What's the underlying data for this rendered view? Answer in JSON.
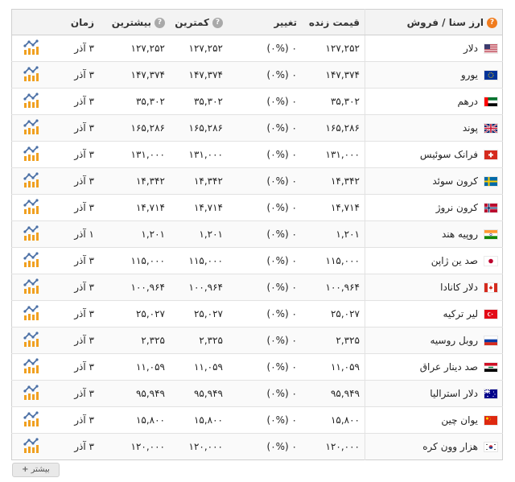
{
  "header": {
    "currency": "ارز سنا / فروش",
    "price": "قیمت زنده",
    "change": "تغییر",
    "low": "کمترین",
    "high": "بیشترین",
    "time": "زمان",
    "help_icon": "?"
  },
  "rows": [
    {
      "name": "دلار",
      "flag": "us-flag-icon",
      "price": "۱۲۷,۲۵۲",
      "change": "۰ (۰%)",
      "low": "۱۲۷,۲۵۲",
      "high": "۱۲۷,۲۵۲",
      "time": "۳ آذر"
    },
    {
      "name": "یورو",
      "flag": "eu-flag-icon",
      "price": "۱۴۷,۳۷۴",
      "change": "۰ (۰%)",
      "low": "۱۴۷,۳۷۴",
      "high": "۱۴۷,۳۷۴",
      "time": "۳ آذر"
    },
    {
      "name": "درهم",
      "flag": "ae-flag-icon",
      "price": "۳۵,۳۰۲",
      "change": "۰ (۰%)",
      "low": "۳۵,۳۰۲",
      "high": "۳۵,۳۰۲",
      "time": "۳ آذر"
    },
    {
      "name": "پوند",
      "flag": "gb-flag-icon",
      "price": "۱۶۵,۲۸۶",
      "change": "۰ (۰%)",
      "low": "۱۶۵,۲۸۶",
      "high": "۱۶۵,۲۸۶",
      "time": "۳ آذر"
    },
    {
      "name": "فرانک سوئیس",
      "flag": "ch-flag-icon",
      "price": "۱۳۱,۰۰۰",
      "change": "۰ (۰%)",
      "low": "۱۳۱,۰۰۰",
      "high": "۱۳۱,۰۰۰",
      "time": "۳ آذر"
    },
    {
      "name": "کرون سوئد",
      "flag": "se-flag-icon",
      "price": "۱۴,۳۴۲",
      "change": "۰ (۰%)",
      "low": "۱۴,۳۴۲",
      "high": "۱۴,۳۴۲",
      "time": "۳ آذر"
    },
    {
      "name": "کرون نروژ",
      "flag": "no-flag-icon",
      "price": "۱۴,۷۱۴",
      "change": "۰ (۰%)",
      "low": "۱۴,۷۱۴",
      "high": "۱۴,۷۱۴",
      "time": "۳ آذر"
    },
    {
      "name": "روپیه هند",
      "flag": "in-flag-icon",
      "price": "۱,۲۰۱",
      "change": "۰ (۰%)",
      "low": "۱,۲۰۱",
      "high": "۱,۲۰۱",
      "time": "۱ آذر"
    },
    {
      "name": "صد ین ژاپن",
      "flag": "jp-flag-icon",
      "price": "۱۱۵,۰۰۰",
      "change": "۰ (۰%)",
      "low": "۱۱۵,۰۰۰",
      "high": "۱۱۵,۰۰۰",
      "time": "۳ آذر"
    },
    {
      "name": "دلار کانادا",
      "flag": "ca-flag-icon",
      "price": "۱۰۰,۹۶۴",
      "change": "۰ (۰%)",
      "low": "۱۰۰,۹۶۴",
      "high": "۱۰۰,۹۶۴",
      "time": "۳ آذر"
    },
    {
      "name": "لیر ترکیه",
      "flag": "tr-flag-icon",
      "price": "۲۵,۰۲۷",
      "change": "۰ (۰%)",
      "low": "۲۵,۰۲۷",
      "high": "۲۵,۰۲۷",
      "time": "۳ آذر"
    },
    {
      "name": "روبل روسیه",
      "flag": "ru-flag-icon",
      "price": "۲,۳۲۵",
      "change": "۰ (۰%)",
      "low": "۲,۳۲۵",
      "high": "۲,۳۲۵",
      "time": "۳ آذر"
    },
    {
      "name": "صد دینار عراق",
      "flag": "iq-flag-icon",
      "price": "۱۱,۰۵۹",
      "change": "۰ (۰%)",
      "low": "۱۱,۰۵۹",
      "high": "۱۱,۰۵۹",
      "time": "۳ آذر"
    },
    {
      "name": "دلار استرالیا",
      "flag": "au-flag-icon",
      "price": "۹۵,۹۴۹",
      "change": "۰ (۰%)",
      "low": "۹۵,۹۴۹",
      "high": "۹۵,۹۴۹",
      "time": "۳ آذر"
    },
    {
      "name": "یوان چین",
      "flag": "cn-flag-icon",
      "price": "۱۵,۸۰۰",
      "change": "۰ (۰%)",
      "low": "۱۵,۸۰۰",
      "high": "۱۵,۸۰۰",
      "time": "۳ آذر"
    },
    {
      "name": "هزار وون کره",
      "flag": "kr-flag-icon",
      "price": "۱۲۰,۰۰۰",
      "change": "۰ (۰%)",
      "low": "۱۲۰,۰۰۰",
      "high": "۱۲۰,۰۰۰",
      "time": "۳ آذر"
    }
  ],
  "chart_icon": "chart-icon",
  "more_button": {
    "label": "بیشتر",
    "icon": "plus-icon"
  },
  "colors": {
    "help_orange": "#f07b1d",
    "help_gray": "#a9a9a9",
    "chart_blue": "#4a6fa5",
    "chart_orange": "#f0a020"
  }
}
